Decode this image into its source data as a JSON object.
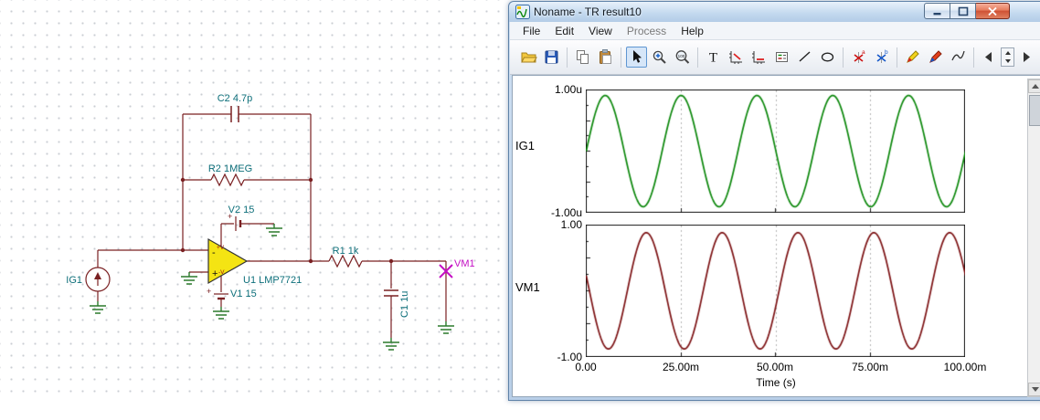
{
  "window": {
    "title": "Noname - TR result10",
    "menu": {
      "items": [
        {
          "label": "File"
        },
        {
          "label": "Edit"
        },
        {
          "label": "View"
        },
        {
          "label": "Process"
        },
        {
          "label": "Help"
        }
      ]
    },
    "toolbar": {
      "icons": [
        "open",
        "save",
        "copy",
        "paste",
        "select-cursor",
        "zoom-in",
        "zoom-100",
        "text",
        "axis-x-scale",
        "axis-y-scale",
        "legend",
        "line",
        "ellipse",
        "cursor-a",
        "cursor-b",
        "marker-yellow",
        "marker-red",
        "interpolate",
        "page-left",
        "interval-spinner",
        "page-right"
      ],
      "selected_tool": "select-cursor",
      "text_tool_glyph": "T",
      "zoom100_text": "100",
      "cursor_a_letter": "a",
      "cursor_b_letter": "b"
    }
  },
  "schematic": {
    "components": {
      "c2": {
        "label": "C2 4.7p"
      },
      "r2": {
        "label": "R2 1MEG"
      },
      "v2": {
        "label": "V2 15",
        "polarity": "+"
      },
      "v1": {
        "label": "V1 15",
        "polarity": "+"
      },
      "opamp": {
        "label": "U1 LMP7721",
        "inverting": "-",
        "noninverting": "+",
        "vplus": "+V",
        "vminus": "-V"
      },
      "ig1": {
        "label": "IG1"
      },
      "r1": {
        "label": "R1 1k"
      },
      "c1": {
        "label": "C1 1u"
      },
      "vm1": {
        "label": "VM1"
      }
    },
    "colors": {
      "wire": "#7a2022",
      "label": "#0d6f7a",
      "meter": "#c410c4",
      "ground": "#2c7a2c",
      "opamp_fill": "#f4e413"
    }
  },
  "chart_data": [
    {
      "type": "line",
      "name": "IG1",
      "y_tick_top": "1.00u",
      "y_tick_bottom": "-1.00u",
      "ylim": [
        -1e-06,
        1e-06
      ],
      "x_span_s": [
        0,
        0.1
      ],
      "grid_fractions": [
        0.25,
        0.5,
        0.75
      ],
      "series": {
        "name": "IG1",
        "color": "#0b870b",
        "waveform": "sine",
        "frequency_hz": 50,
        "amplitude": 1e-06,
        "amplitude_fraction": 0.96,
        "phase_deg": 0
      }
    },
    {
      "type": "line",
      "name": "VM1",
      "y_tick_top": "1.00",
      "y_tick_bottom": "-1.00",
      "ylim": [
        -1,
        1
      ],
      "x_span_s": [
        0,
        0.1
      ],
      "grid_fractions": [
        0.25,
        0.5,
        0.75
      ],
      "series": {
        "name": "VM1",
        "color": "#7c1113",
        "waveform": "sine",
        "frequency_hz": 50,
        "amplitude": 0.93,
        "amplitude_fraction": 0.93,
        "phase_deg": 165
      }
    }
  ],
  "x_axis": {
    "tick_labels": [
      "0.00",
      "25.00m",
      "50.00m",
      "75.00m",
      "100.00m"
    ],
    "title": "Time (s)"
  }
}
